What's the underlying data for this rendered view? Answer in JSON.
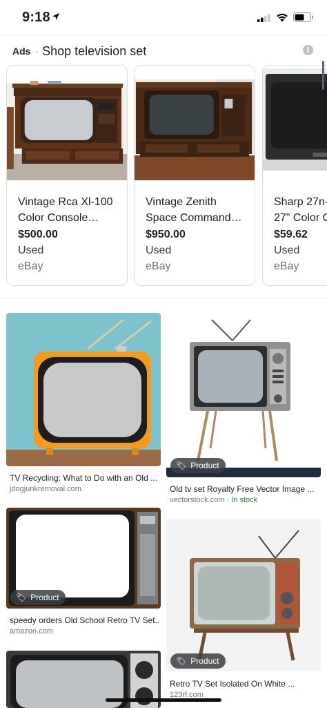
{
  "status_bar": {
    "time": "9:18"
  },
  "ads": {
    "label": "Ads",
    "separator": "·",
    "title": "Shop television set",
    "info": "i",
    "products": [
      {
        "name_line1": "Vintage Rca Xl-100",
        "name_line2": "Color Console…",
        "price": "$500.00",
        "condition": "Used",
        "store": "eBay"
      },
      {
        "name_line1": "Vintage Zenith",
        "name_line2": "Space Command…",
        "price": "$950.00",
        "condition": "Used",
        "store": "eBay"
      },
      {
        "name_line1": "Sharp 27n-",
        "name_line2": "27\" Color C",
        "price": "$59.62",
        "condition": "Used",
        "store": "eBay"
      }
    ]
  },
  "results": [
    {
      "caption": "TV Recycling: What to Do with an Old ...",
      "source": "jdogjunkremoval.com",
      "badge": ""
    },
    {
      "caption": "Old tv set Royalty Free Vector Image ...",
      "source": "vectorstock.com",
      "extra": " · In stock",
      "badge": "Product"
    },
    {
      "caption": "speedy orders Old School Retro TV Set...",
      "source": "amazon.com",
      "badge": "Product"
    },
    {
      "caption": "Retro TV Set Isolated On White ...",
      "source": "123rf.com",
      "badge": "Product"
    }
  ],
  "colors": {
    "accent_green": "#188038",
    "text": "#202124",
    "muted": "#70757a"
  }
}
